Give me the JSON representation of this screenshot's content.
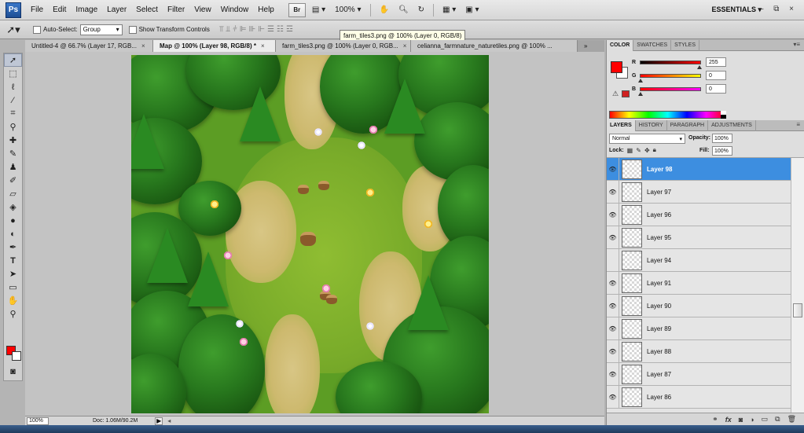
{
  "app": {
    "logo": "Ps",
    "workspace": "ESSENTIALS",
    "window_controls": "– ⧉ ×"
  },
  "menu": [
    "File",
    "Edit",
    "Image",
    "Layer",
    "Select",
    "Filter",
    "View",
    "Window",
    "Help"
  ],
  "menu_tools": {
    "bridge": "Br",
    "zoom_level": "100%"
  },
  "options": {
    "auto_select_label": "Auto-Select:",
    "auto_select_value": "Group",
    "show_transform_label": "Show Transform Controls",
    "tooltip": "farm_tiles3.png @ 100% (Layer 0, RGB/8)"
  },
  "doc_tabs": [
    {
      "label": "Untitled-4 @ 66.7% (Layer 17, RGB...",
      "active": false
    },
    {
      "label": "Map @ 100% (Layer 98, RGB/8) *",
      "active": true
    },
    {
      "label": "farm_tiles3.png @ 100% (Layer 0, RGB...",
      "active": false
    },
    {
      "label": "celianna_farmnature_naturetiles.png @ 100% ...",
      "active": false
    }
  ],
  "status": {
    "zoom": "100%",
    "doc_info": "Doc: 1.06M/90.2M"
  },
  "color_panel": {
    "tabs": [
      "COLOR",
      "SWATCHES",
      "STYLES"
    ],
    "channels": [
      {
        "label": "R",
        "value": "255",
        "fraction": 1.0,
        "gradient": "linear-gradient(90deg,#000,#f00)"
      },
      {
        "label": "G",
        "value": "0",
        "fraction": 0.0,
        "gradient": "linear-gradient(90deg,#f00,#ff0)"
      },
      {
        "label": "B",
        "value": "0",
        "fraction": 0.0,
        "gradient": "linear-gradient(90deg,#f00,#f0f)"
      }
    ],
    "foreground_color": "#ff0000",
    "background_color": "#ffffff"
  },
  "layers_panel": {
    "tabs": [
      "LAYERS",
      "HISTORY",
      "PARAGRAPH",
      "ADJUSTMENTS"
    ],
    "blend_mode": "Normal",
    "opacity_label": "Opacity:",
    "opacity": "100%",
    "lock_label": "Lock:",
    "fill_label": "Fill:",
    "fill": "100%",
    "layers": [
      {
        "name": "Layer 98",
        "visible": true,
        "selected": true
      },
      {
        "name": "Layer 97",
        "visible": true,
        "selected": false
      },
      {
        "name": "Layer 96",
        "visible": true,
        "selected": false
      },
      {
        "name": "Layer 95",
        "visible": true,
        "selected": false
      },
      {
        "name": "Layer 94",
        "visible": false,
        "selected": false
      },
      {
        "name": "Layer 91",
        "visible": true,
        "selected": false
      },
      {
        "name": "Layer 90",
        "visible": true,
        "selected": false
      },
      {
        "name": "Layer 89",
        "visible": true,
        "selected": false
      },
      {
        "name": "Layer 88",
        "visible": true,
        "selected": false
      },
      {
        "name": "Layer 87",
        "visible": true,
        "selected": false
      },
      {
        "name": "Layer 86",
        "visible": true,
        "selected": false
      }
    ],
    "footer_icons": [
      "link-icon",
      "fx-icon",
      "mask-icon",
      "adjustment-icon",
      "group-icon",
      "new-layer-icon",
      "trash-icon"
    ]
  },
  "tools": [
    "move-tool-icon",
    "marquee-tool-icon",
    "lasso-tool-icon",
    "quick-select-tool-icon",
    "crop-tool-icon",
    "eyedropper-tool-icon",
    "healing-tool-icon",
    "brush-tool-icon",
    "clone-stamp-tool-icon",
    "history-brush-tool-icon",
    "eraser-tool-icon",
    "paint-bucket-tool-icon",
    "blur-tool-icon",
    "dodge-tool-icon",
    "pen-tool-icon",
    "type-tool-icon",
    "path-select-tool-icon",
    "shape-tool-icon",
    "hand-tool-icon",
    "zoom-tool-icon"
  ]
}
